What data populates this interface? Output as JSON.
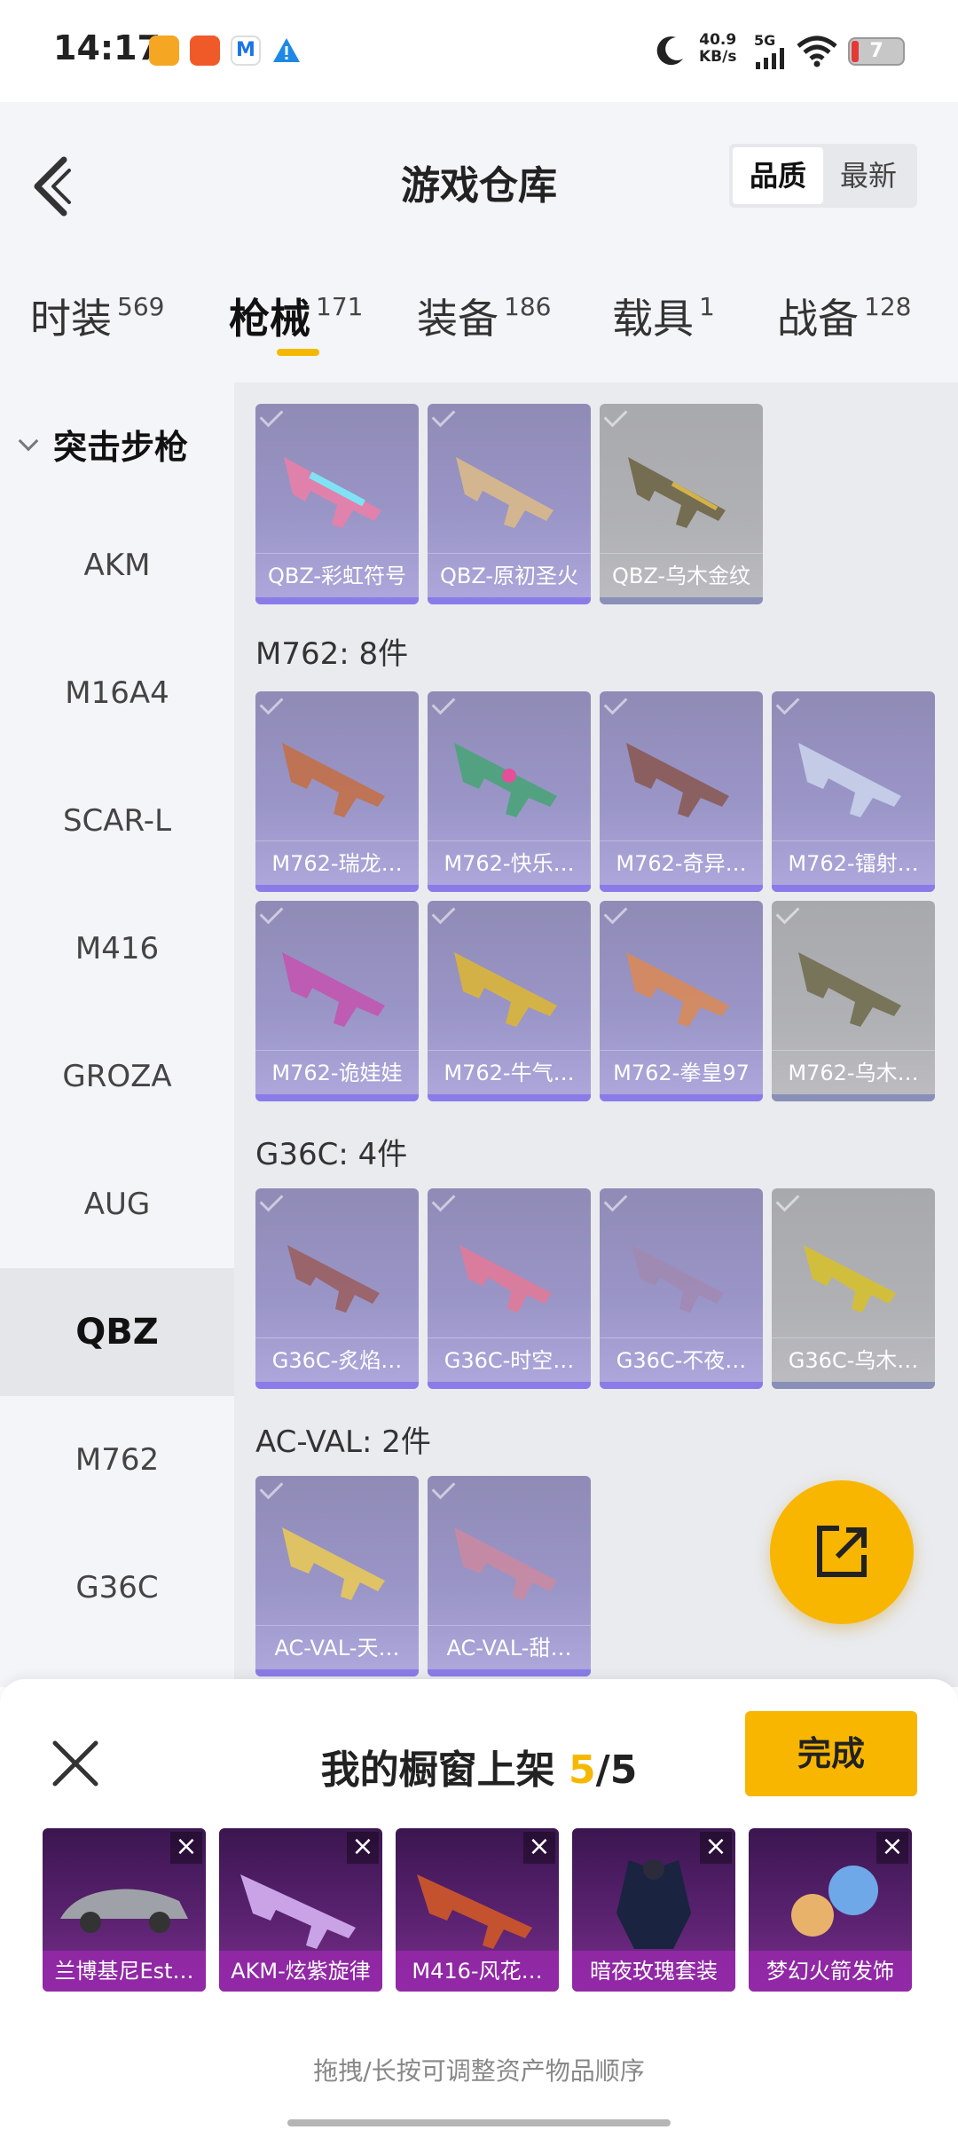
{
  "status": {
    "time": "14:17",
    "net_speed": "40.9",
    "net_unit": "KB/s",
    "signal_label": "5G",
    "battery": "7",
    "colors": {
      "battery_low": "#e53935"
    }
  },
  "header": {
    "title": "游戏仓库",
    "sort_quality": "品质",
    "sort_latest": "最新"
  },
  "tabs": [
    {
      "label": "时装",
      "count": "569"
    },
    {
      "label": "枪械",
      "count": "171"
    },
    {
      "label": "装备",
      "count": "186"
    },
    {
      "label": "载具",
      "count": "1"
    },
    {
      "label": "战备",
      "count": "128"
    }
  ],
  "sidebar": {
    "category": "突击步枪",
    "items": [
      "AKM",
      "M16A4",
      "SCAR-L",
      "M416",
      "GROZA",
      "AUG",
      "QBZ",
      "M762",
      "G36C"
    ],
    "selected": "QBZ"
  },
  "content": {
    "qbz_items": [
      "QBZ-彩虹符号",
      "QBZ-原初圣火",
      "QBZ-乌木金纹"
    ],
    "m762_header": "M762: 8件",
    "m762_items": [
      "M762-瑞龙…",
      "M762-快乐…",
      "M762-奇异…",
      "M762-镭射…",
      "M762-诡娃娃",
      "M762-牛气…",
      "M762-拳皇97",
      "M762-乌木…"
    ],
    "g36c_header": "G36C: 4件",
    "g36c_items": [
      "G36C-炙焰…",
      "G36C-时空…",
      "G36C-不夜…",
      "G36C-乌木…"
    ],
    "acval_header": "AC-VAL: 2件",
    "acval_items": [
      "AC-VAL-天…",
      "AC-VAL-甜…"
    ]
  },
  "showcase": {
    "title_prefix": "我的橱窗上架",
    "count": "5",
    "total": "/5",
    "done_label": "完成",
    "items": [
      "兰博基尼Est…",
      "AKM-炫紫旋律",
      "M416-风花…",
      "暗夜玫瑰套装",
      "梦幻火箭发饰"
    ],
    "hint": "拖拽/长按可调整资产物品顺序"
  },
  "colors": {
    "accent": "#f8b600"
  }
}
